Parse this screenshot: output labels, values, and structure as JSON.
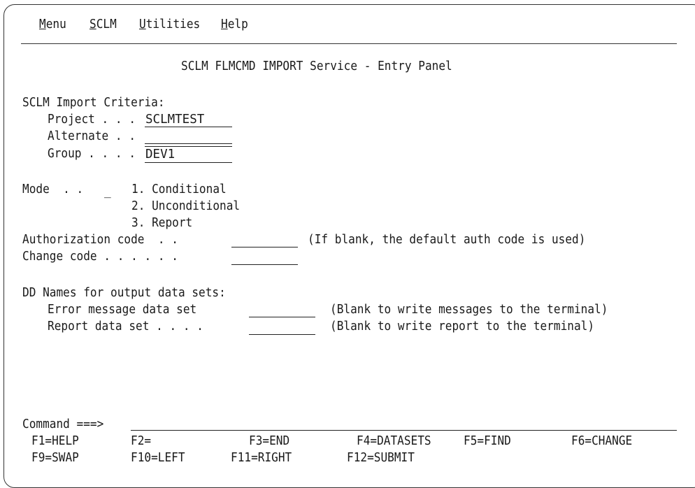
{
  "menu_bar": {
    "items": [
      {
        "underline": "M",
        "rest": "enu"
      },
      {
        "underline": "S",
        "rest": "CLM"
      },
      {
        "underline": "U",
        "rest": "tilities"
      },
      {
        "underline": "H",
        "rest": "elp"
      }
    ]
  },
  "panel": {
    "title": "SCLM FLMCMD IMPORT Service - Entry Panel",
    "criteria_heading": "SCLM Import Criteria:",
    "project_label": "Project . . .",
    "project_value": "SCLMTEST",
    "alternate_label": "Alternate . .",
    "alternate_value": "",
    "group_label": "Group . . . .",
    "group_value": "DEV1",
    "mode_label": "Mode  . .",
    "mode_value": "_",
    "mode_options": [
      "1. Conditional",
      "2. Unconditional",
      "3. Report"
    ],
    "auth_label": "Authorization code  . .",
    "auth_value": "",
    "auth_hint": "(If blank, the default auth code is used)",
    "change_label": "Change code . . . . . .",
    "change_value": "",
    "dd_heading": "DD Names for output data sets:",
    "error_label": "Error message data set",
    "error_value": "",
    "error_hint": "(Blank to write messages to the terminal)",
    "report_label": "Report data set . . . .",
    "report_value": "",
    "report_hint": "(Blank to write report to the terminal)"
  },
  "command": {
    "label": "Command ===>",
    "value": ""
  },
  "function_keys": [
    "F1=HELP",
    "F2=",
    "F3=END",
    "F4=DATASETS",
    "F5=FIND",
    "F6=CHANGE",
    "F9=SWAP",
    "F10=LEFT",
    "F11=RIGHT",
    "F12=SUBMIT"
  ]
}
